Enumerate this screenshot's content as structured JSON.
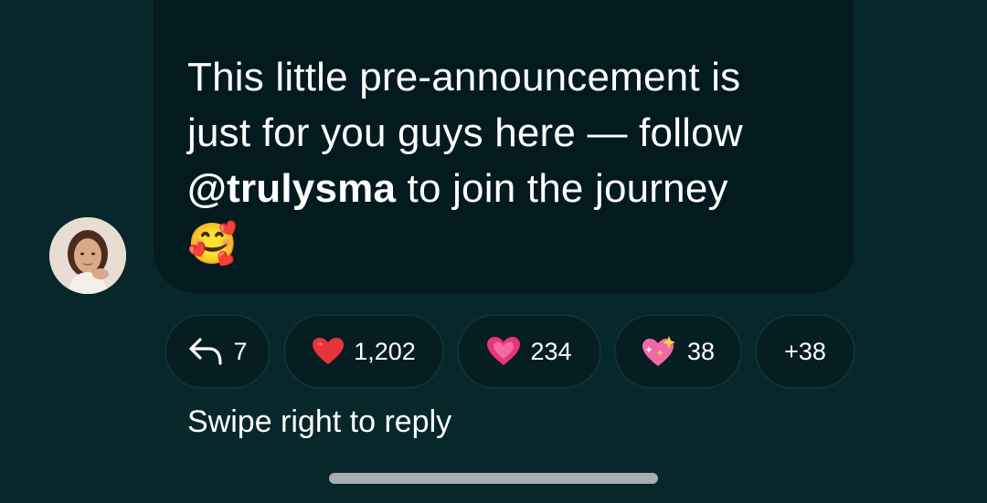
{
  "message": {
    "line1": "This little pre-announcement is",
    "line2": "just for you guys here — follow",
    "mention_glyph": "@",
    "mention_handle": "trulysma",
    "line3_rest": " to join the journey",
    "emoji": "🥰"
  },
  "reactions": [
    {
      "icon": "reply-arrow-icon",
      "count": "7"
    },
    {
      "icon": "red-heart-icon",
      "count": "1,202"
    },
    {
      "icon": "pink-heart-icon",
      "count": "234"
    },
    {
      "icon": "sparkling-heart-icon",
      "count": "38"
    },
    {
      "icon": "",
      "count": "+38"
    }
  ],
  "hint": "Swipe right to reply",
  "colors": {
    "background": "#08272a",
    "bubble": "#031a1e",
    "pill_border": "#0f3236",
    "text": "#ffffff"
  }
}
